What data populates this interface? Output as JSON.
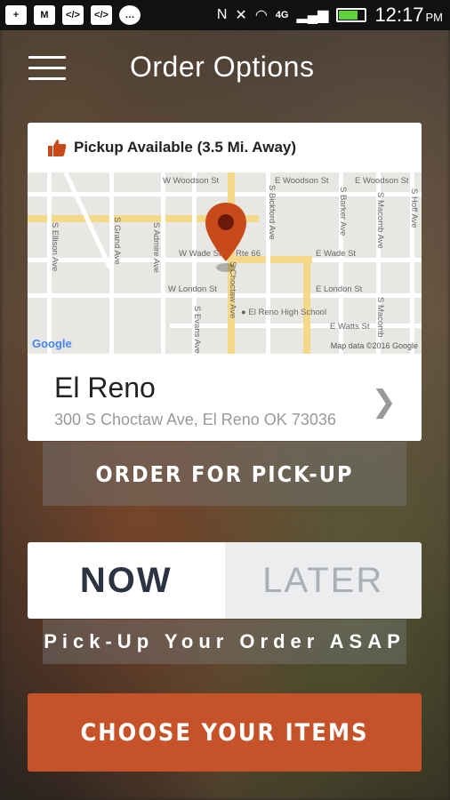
{
  "statusbar": {
    "time": "12:17",
    "ampm": "PM",
    "network": "4G",
    "left_icons": [
      "add-icon",
      "gmail-icon",
      "code-icon",
      "code-icon",
      "message-icon"
    ],
    "right_icons": [
      "nfc-icon",
      "mute-icon",
      "wifi-icon",
      "signal-icon",
      "battery-icon"
    ]
  },
  "header": {
    "title": "Order Options",
    "menu_icon": "hamburger-menu-icon"
  },
  "store_card": {
    "pickup_status": "Pickup Available (3.5 Mi. Away)",
    "pickup_icon": "thumbs-up-icon",
    "map": {
      "labels": {
        "w_woodson": "W Woodson St",
        "e_woodson": "E Woodson St",
        "e_woodson2": "E Woodson St",
        "w_wade": "W Wade St",
        "rte66": "Rte 66",
        "e_wade": "E Wade St",
        "w_london": "W London St",
        "e_london": "E London St",
        "e_watts": "E Watts St",
        "high_school": "El Reno High School",
        "s_ellison": "S Ellison Ave",
        "s_grand": "S Grand Ave",
        "s_admire": "S Admire Ave",
        "s_evans": "S Evans Ave",
        "s_choctaw": "S Choctaw Ave",
        "s_bickford": "S Bickford Ave",
        "s_barker": "S Barker Ave",
        "s_macomb": "S Macomb Ave",
        "s_macomb2": "S Macomb",
        "s_hoff": "S Hoff Ave",
        "google": "Google",
        "map_data": "Map data ©2016 Google"
      }
    },
    "location_name": "El Reno",
    "location_address": "300 S Choctaw Ave, El Reno OK 73036"
  },
  "order_type_label": "ORDER FOR PICK-UP",
  "timing": {
    "now_label": "NOW",
    "later_label": "LATER",
    "selected": "NOW",
    "description": "Pick-Up Your Order ASAP"
  },
  "cta_label": "CHOOSE YOUR ITEMS",
  "colors": {
    "accent": "#c55228",
    "now_text": "#2b3440",
    "later_bg": "#ebedee",
    "pin": "#c84a1a"
  }
}
